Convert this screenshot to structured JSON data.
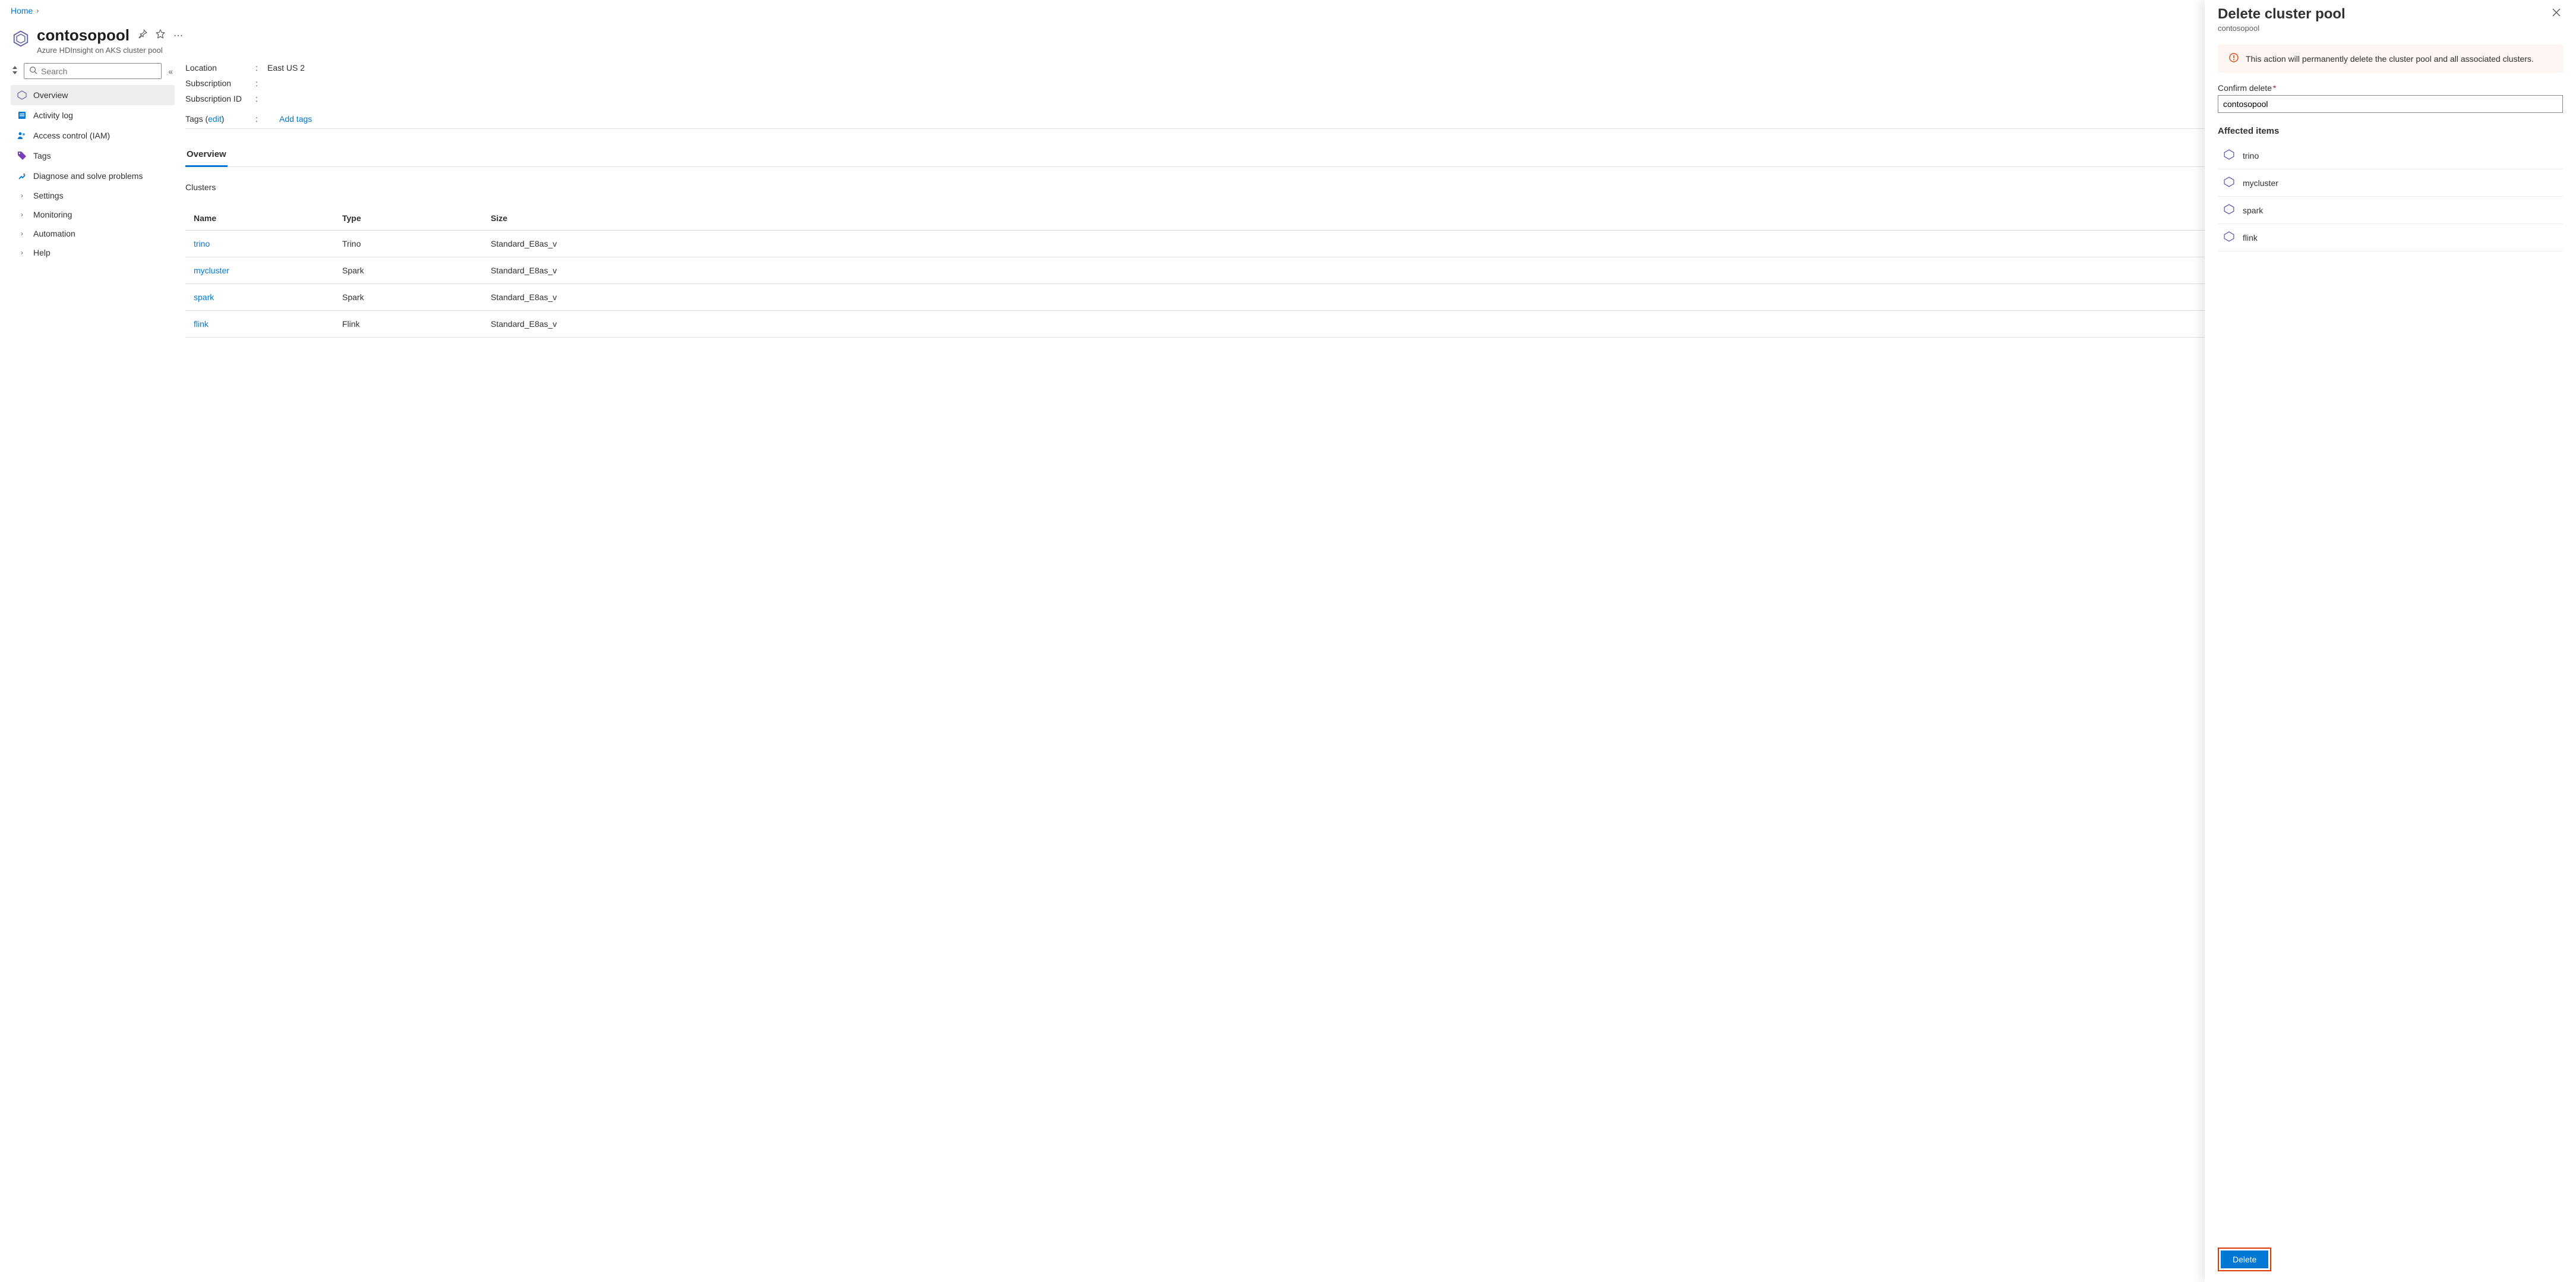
{
  "breadcrumb": {
    "home": "Home"
  },
  "header": {
    "title": "contosopool",
    "subtitle": "Azure HDInsight on AKS cluster pool"
  },
  "search": {
    "placeholder": "Search"
  },
  "sidebar": {
    "items": [
      {
        "label": "Overview",
        "active": true
      },
      {
        "label": "Activity log"
      },
      {
        "label": "Access control (IAM)"
      },
      {
        "label": "Tags"
      },
      {
        "label": "Diagnose and solve problems"
      },
      {
        "label": "Settings",
        "expandable": true
      },
      {
        "label": "Monitoring",
        "expandable": true
      },
      {
        "label": "Automation",
        "expandable": true
      },
      {
        "label": "Help",
        "expandable": true
      }
    ]
  },
  "props": {
    "location_label": "Location",
    "location_value": "East US 2",
    "subscription_label": "Subscription",
    "subscription_value": "",
    "subscription_id_label": "Subscription ID",
    "subscription_id_value": "",
    "tags_label": "Tags",
    "tags_edit": "edit",
    "add_tags": "Add tags"
  },
  "tabs": {
    "overview": "Overview"
  },
  "clusters": {
    "section_label": "Clusters",
    "headers": {
      "name": "Name",
      "type": "Type",
      "size": "Size"
    },
    "rows": [
      {
        "name": "trino",
        "type": "Trino",
        "size": "Standard_E8as_v"
      },
      {
        "name": "mycluster",
        "type": "Spark",
        "size": "Standard_E8as_v"
      },
      {
        "name": "spark",
        "type": "Spark",
        "size": "Standard_E8as_v"
      },
      {
        "name": "flink",
        "type": "Flink",
        "size": "Standard_E8as_v"
      }
    ]
  },
  "panel": {
    "title": "Delete cluster pool",
    "sub": "contosopool",
    "warning": "This action will permanently delete the cluster pool and all associated clusters.",
    "confirm_label": "Confirm delete",
    "confirm_value": "contosopool",
    "affected_title": "Affected items",
    "affected": [
      "trino",
      "mycluster",
      "spark",
      "flink"
    ],
    "delete_btn": "Delete"
  }
}
